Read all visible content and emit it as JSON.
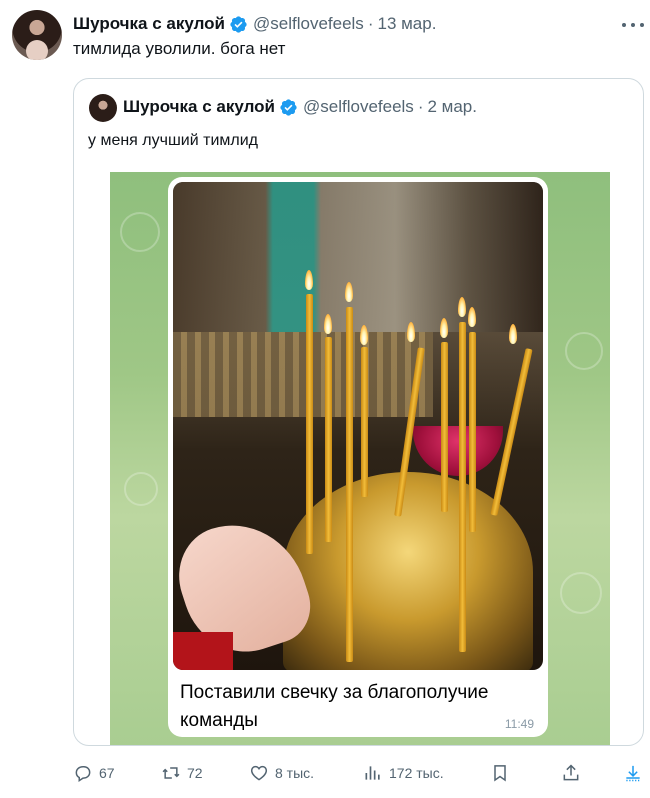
{
  "tweet": {
    "author_name": "Шурочка с акулой",
    "handle": "@selflovefeels",
    "separator": "·",
    "date": "13 мар.",
    "text": "тимлида уволили. бога нет"
  },
  "quote": {
    "author_name": "Шурочка с акулой",
    "handle": "@selflovefeels",
    "separator": "·",
    "date": "2 мар.",
    "text": "у меня лучший тимлид",
    "media": {
      "caption": "Поставили свечку за благополучие команды",
      "time": "11:49"
    }
  },
  "actions": {
    "replies": "67",
    "reposts": "72",
    "likes": "8 тыс.",
    "views": "172 тыс."
  },
  "colors": {
    "verified": "#1d9bf0",
    "muted": "#536471",
    "accent_download": "#1d9bf0"
  }
}
